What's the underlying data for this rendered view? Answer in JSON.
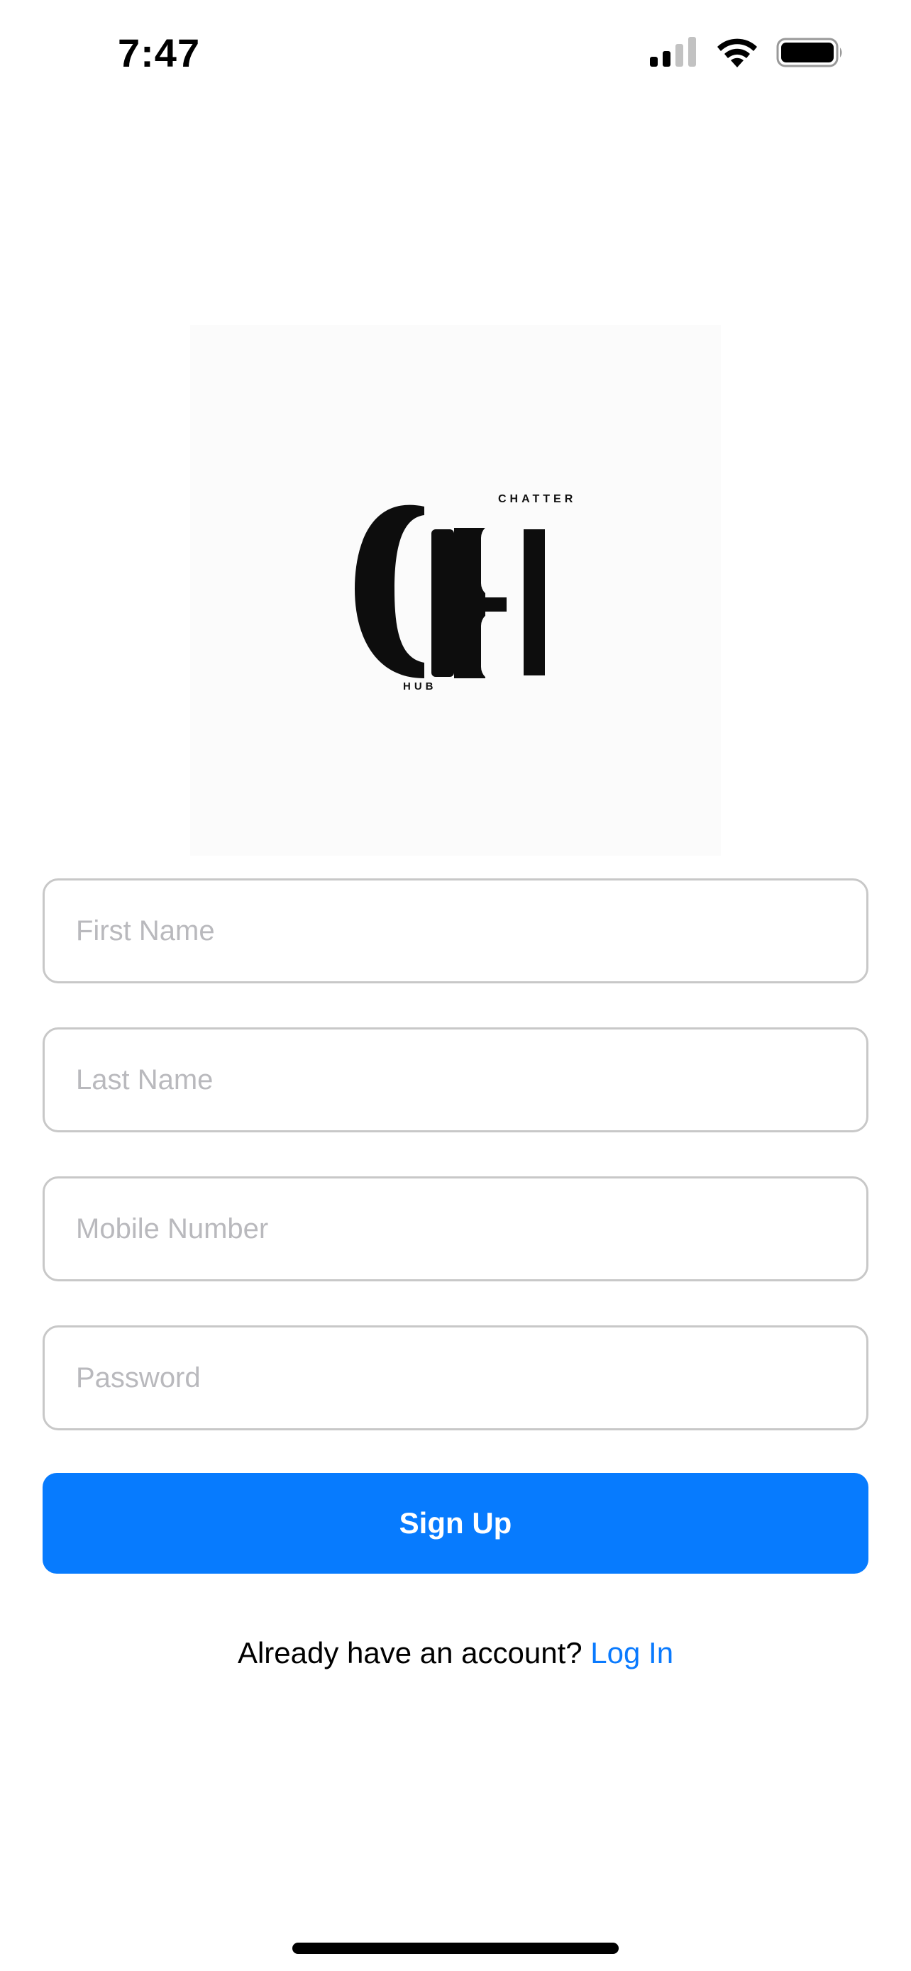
{
  "status_bar": {
    "time": "7:47",
    "icons": [
      "cellular-signal-icon",
      "wifi-icon",
      "battery-icon"
    ]
  },
  "logo": {
    "top_text": "CHATTER",
    "bottom_text": "HUB",
    "monogram": "CH"
  },
  "form": {
    "first_name_placeholder": "First Name",
    "last_name_placeholder": "Last Name",
    "mobile_placeholder": "Mobile Number",
    "password_placeholder": "Password",
    "first_name_value": "",
    "last_name_value": "",
    "mobile_value": "",
    "password_value": ""
  },
  "signup_button": {
    "label": "Sign Up",
    "color": "#077bfe"
  },
  "login_prompt": {
    "text": "Already have an account?",
    "link_label": "Log In",
    "link_color": "#0a7afe"
  }
}
